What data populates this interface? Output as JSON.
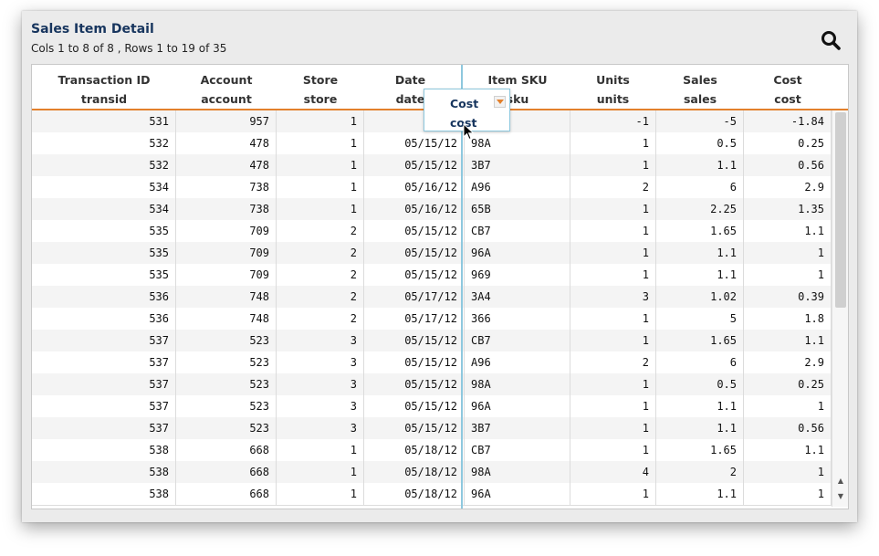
{
  "header": {
    "title": "Sales Item Detail",
    "subtitle": "Cols 1 to 8 of 8 , Rows 1 to 19 of 35",
    "search_icon": "search-icon"
  },
  "columns": [
    {
      "label": "Transaction ID",
      "field": "transid"
    },
    {
      "label": "Account",
      "field": "account"
    },
    {
      "label": "Store",
      "field": "store"
    },
    {
      "label": "Date",
      "field": "date"
    },
    {
      "label": "Item SKU",
      "field": "sku"
    },
    {
      "label": "Units",
      "field": "units"
    },
    {
      "label": "Sales",
      "field": "sales"
    },
    {
      "label": "Cost",
      "field": "cost"
    }
  ],
  "drag_popup": {
    "label": "Cost",
    "field": "cost"
  },
  "rows": [
    [
      "531",
      "957",
      "1",
      "05/1",
      "",
      "-1",
      "-5",
      "-1.84"
    ],
    [
      "532",
      "478",
      "1",
      "05/15/12",
      "98A",
      "1",
      "0.5",
      "0.25"
    ],
    [
      "532",
      "478",
      "1",
      "05/15/12",
      "3B7",
      "1",
      "1.1",
      "0.56"
    ],
    [
      "534",
      "738",
      "1",
      "05/16/12",
      "A96",
      "2",
      "6",
      "2.9"
    ],
    [
      "534",
      "738",
      "1",
      "05/16/12",
      "65B",
      "1",
      "2.25",
      "1.35"
    ],
    [
      "535",
      "709",
      "2",
      "05/15/12",
      "CB7",
      "1",
      "1.65",
      "1.1"
    ],
    [
      "535",
      "709",
      "2",
      "05/15/12",
      "96A",
      "1",
      "1.1",
      "1"
    ],
    [
      "535",
      "709",
      "2",
      "05/15/12",
      "969",
      "1",
      "1.1",
      "1"
    ],
    [
      "536",
      "748",
      "2",
      "05/17/12",
      "3A4",
      "3",
      "1.02",
      "0.39"
    ],
    [
      "536",
      "748",
      "2",
      "05/17/12",
      "366",
      "1",
      "5",
      "1.8"
    ],
    [
      "537",
      "523",
      "3",
      "05/15/12",
      "CB7",
      "1",
      "1.65",
      "1.1"
    ],
    [
      "537",
      "523",
      "3",
      "05/15/12",
      "A96",
      "2",
      "6",
      "2.9"
    ],
    [
      "537",
      "523",
      "3",
      "05/15/12",
      "98A",
      "1",
      "0.5",
      "0.25"
    ],
    [
      "537",
      "523",
      "3",
      "05/15/12",
      "96A",
      "1",
      "1.1",
      "1"
    ],
    [
      "537",
      "523",
      "3",
      "05/15/12",
      "3B7",
      "1",
      "1.1",
      "0.56"
    ],
    [
      "538",
      "668",
      "1",
      "05/18/12",
      "CB7",
      "1",
      "1.65",
      "1.1"
    ],
    [
      "538",
      "668",
      "1",
      "05/18/12",
      "98A",
      "4",
      "2",
      "1"
    ],
    [
      "538",
      "668",
      "1",
      "05/18/12",
      "96A",
      "1",
      "1.1",
      "1"
    ]
  ],
  "scroll": {
    "visible_rows_fraction": 0.54
  }
}
